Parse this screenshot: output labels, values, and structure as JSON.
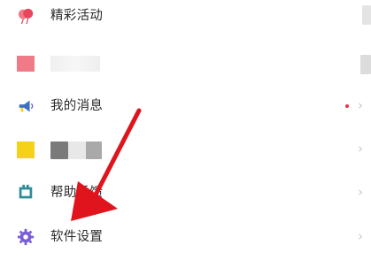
{
  "menu": {
    "items": [
      {
        "label": "精彩活动",
        "icon": "balloon-icon"
      },
      {
        "label": "",
        "icon": "pink-square-icon"
      },
      {
        "label": "我的消息",
        "icon": "megaphone-icon",
        "has_unread_dot": true
      },
      {
        "label": "",
        "icon": "yellow-square-icon"
      },
      {
        "label": "帮助反馈",
        "icon": "feedback-icon"
      },
      {
        "label": "软件设置",
        "icon": "gear-icon"
      }
    ],
    "chevron": "›"
  },
  "colors": {
    "accent_red": "#e8304a",
    "arrow_red": "#e0141c",
    "icon_purple": "#7a5cd6",
    "icon_yellow": "#f5d117",
    "icon_pink": "#f07a87",
    "icon_teal": "#2e8c96"
  }
}
